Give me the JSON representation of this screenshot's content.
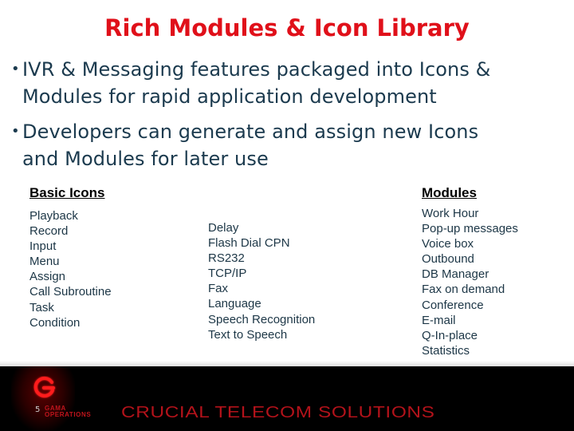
{
  "slide": {
    "title": "Rich Modules & Icon Library",
    "bullets": [
      {
        "line1": "IVR & Messaging features packaged into Icons &",
        "line2": "Modules for rapid application development"
      },
      {
        "line1": "Developers can generate and assign new Icons",
        "line2": "and Modules for later use"
      }
    ],
    "basic_icons": {
      "heading": "Basic Icons",
      "items": [
        "Playback",
        "Record",
        "Input",
        "Menu",
        "Assign",
        "Call Subroutine",
        "Task",
        "Condition"
      ]
    },
    "more_icons": {
      "items": [
        "Delay",
        "Flash Dial CPN",
        "RS232",
        "TCP/IP",
        "Fax",
        "Language",
        "Speech Recognition",
        "Text to Speech"
      ]
    },
    "modules": {
      "heading": "Modules",
      "items": [
        "Work Hour",
        "Pop-up messages",
        "Voice box",
        "Outbound",
        "DB Manager",
        "Fax on demand",
        "Conference",
        "E-mail",
        "Q-In-place",
        "Statistics"
      ]
    }
  },
  "footer": {
    "page_number": "5",
    "logo_icon": "gama-g-logo",
    "brand_line1": "GAMA",
    "brand_line2": "OPERATIONS",
    "tagline": "CRUCIAL TELECOM SOLUTIONS"
  },
  "colors": {
    "title": "#e0101a",
    "body_text": "#1b3a4e",
    "footer_bg": "#000000",
    "footer_red": "#b3121a"
  }
}
